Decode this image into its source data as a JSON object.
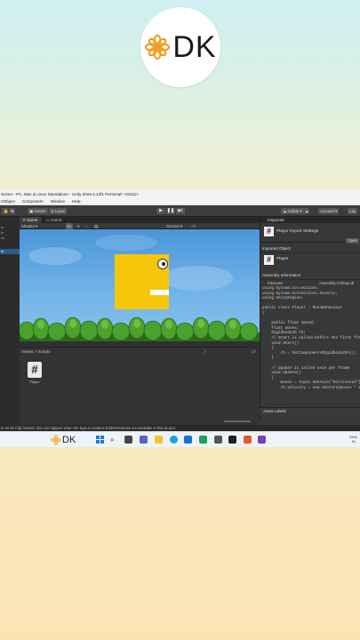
{
  "logo": {
    "text": "DK"
  },
  "unity": {
    "title": "Scene - PC, Mac & Linux Standalone - Unity 2019.4.12f1 Personal* <DX11>",
    "menu": [
      "eObject",
      "Component",
      "Window",
      "Help"
    ],
    "toolbar": {
      "center": "Center",
      "local": "Local",
      "collab": "Collab",
      "account": "Account",
      "layers": "Lay"
    },
    "tabs": {
      "scene": "Scene",
      "game": "Game"
    },
    "scene_bar": {
      "shaded": "Shaded",
      "mode": "2D",
      "gizmos": "Gizmos",
      "search": "All"
    },
    "hierarchy": [
      "m",
      "le",
      "ra",
      "er"
    ],
    "project": {
      "breadcrumb": "Assets > Scripts",
      "asset_name": "Player",
      "count_label": "17"
    },
    "inspector": {
      "tab": "Inspector",
      "title": "Player Import Settings",
      "open_label": "Open",
      "imported_section": "Imported Object",
      "imported_name": "Player",
      "assembly_section": "Assembly Information",
      "filename_label": "Filename",
      "filename_value": "Assembly-CSharp.dl",
      "asset_labels": "Asset Labels"
    },
    "code_lines": [
      "using System.Collections;",
      "using System.Collections.Generic;",
      "using UnityEngine;",
      "",
      "public class Player : MonoBehaviour",
      "{",
      "",
      "    public float speed;",
      "    float movex;",
      "    Rigidbody2D rb;",
      "    // Start is called before the first frame update",
      "    void Start()",
      "    {",
      "        rb = GetComponent<Rigidbody2D>();",
      "    }",
      "",
      "    // Update is called once per frame",
      "    void Update()",
      "    {",
      "        movex = Input.GetAxis(\"Horizontal\");",
      "        rb.velocity = new Vector2(movex * speed, rb.velo"
    ],
    "status": "d not be fully loaded, this can happen when the layout contains EditorWindows not available in this project"
  },
  "taskbar": {
    "logo": "DK",
    "tray_top": "ENG",
    "tray_bottom": "IN"
  }
}
